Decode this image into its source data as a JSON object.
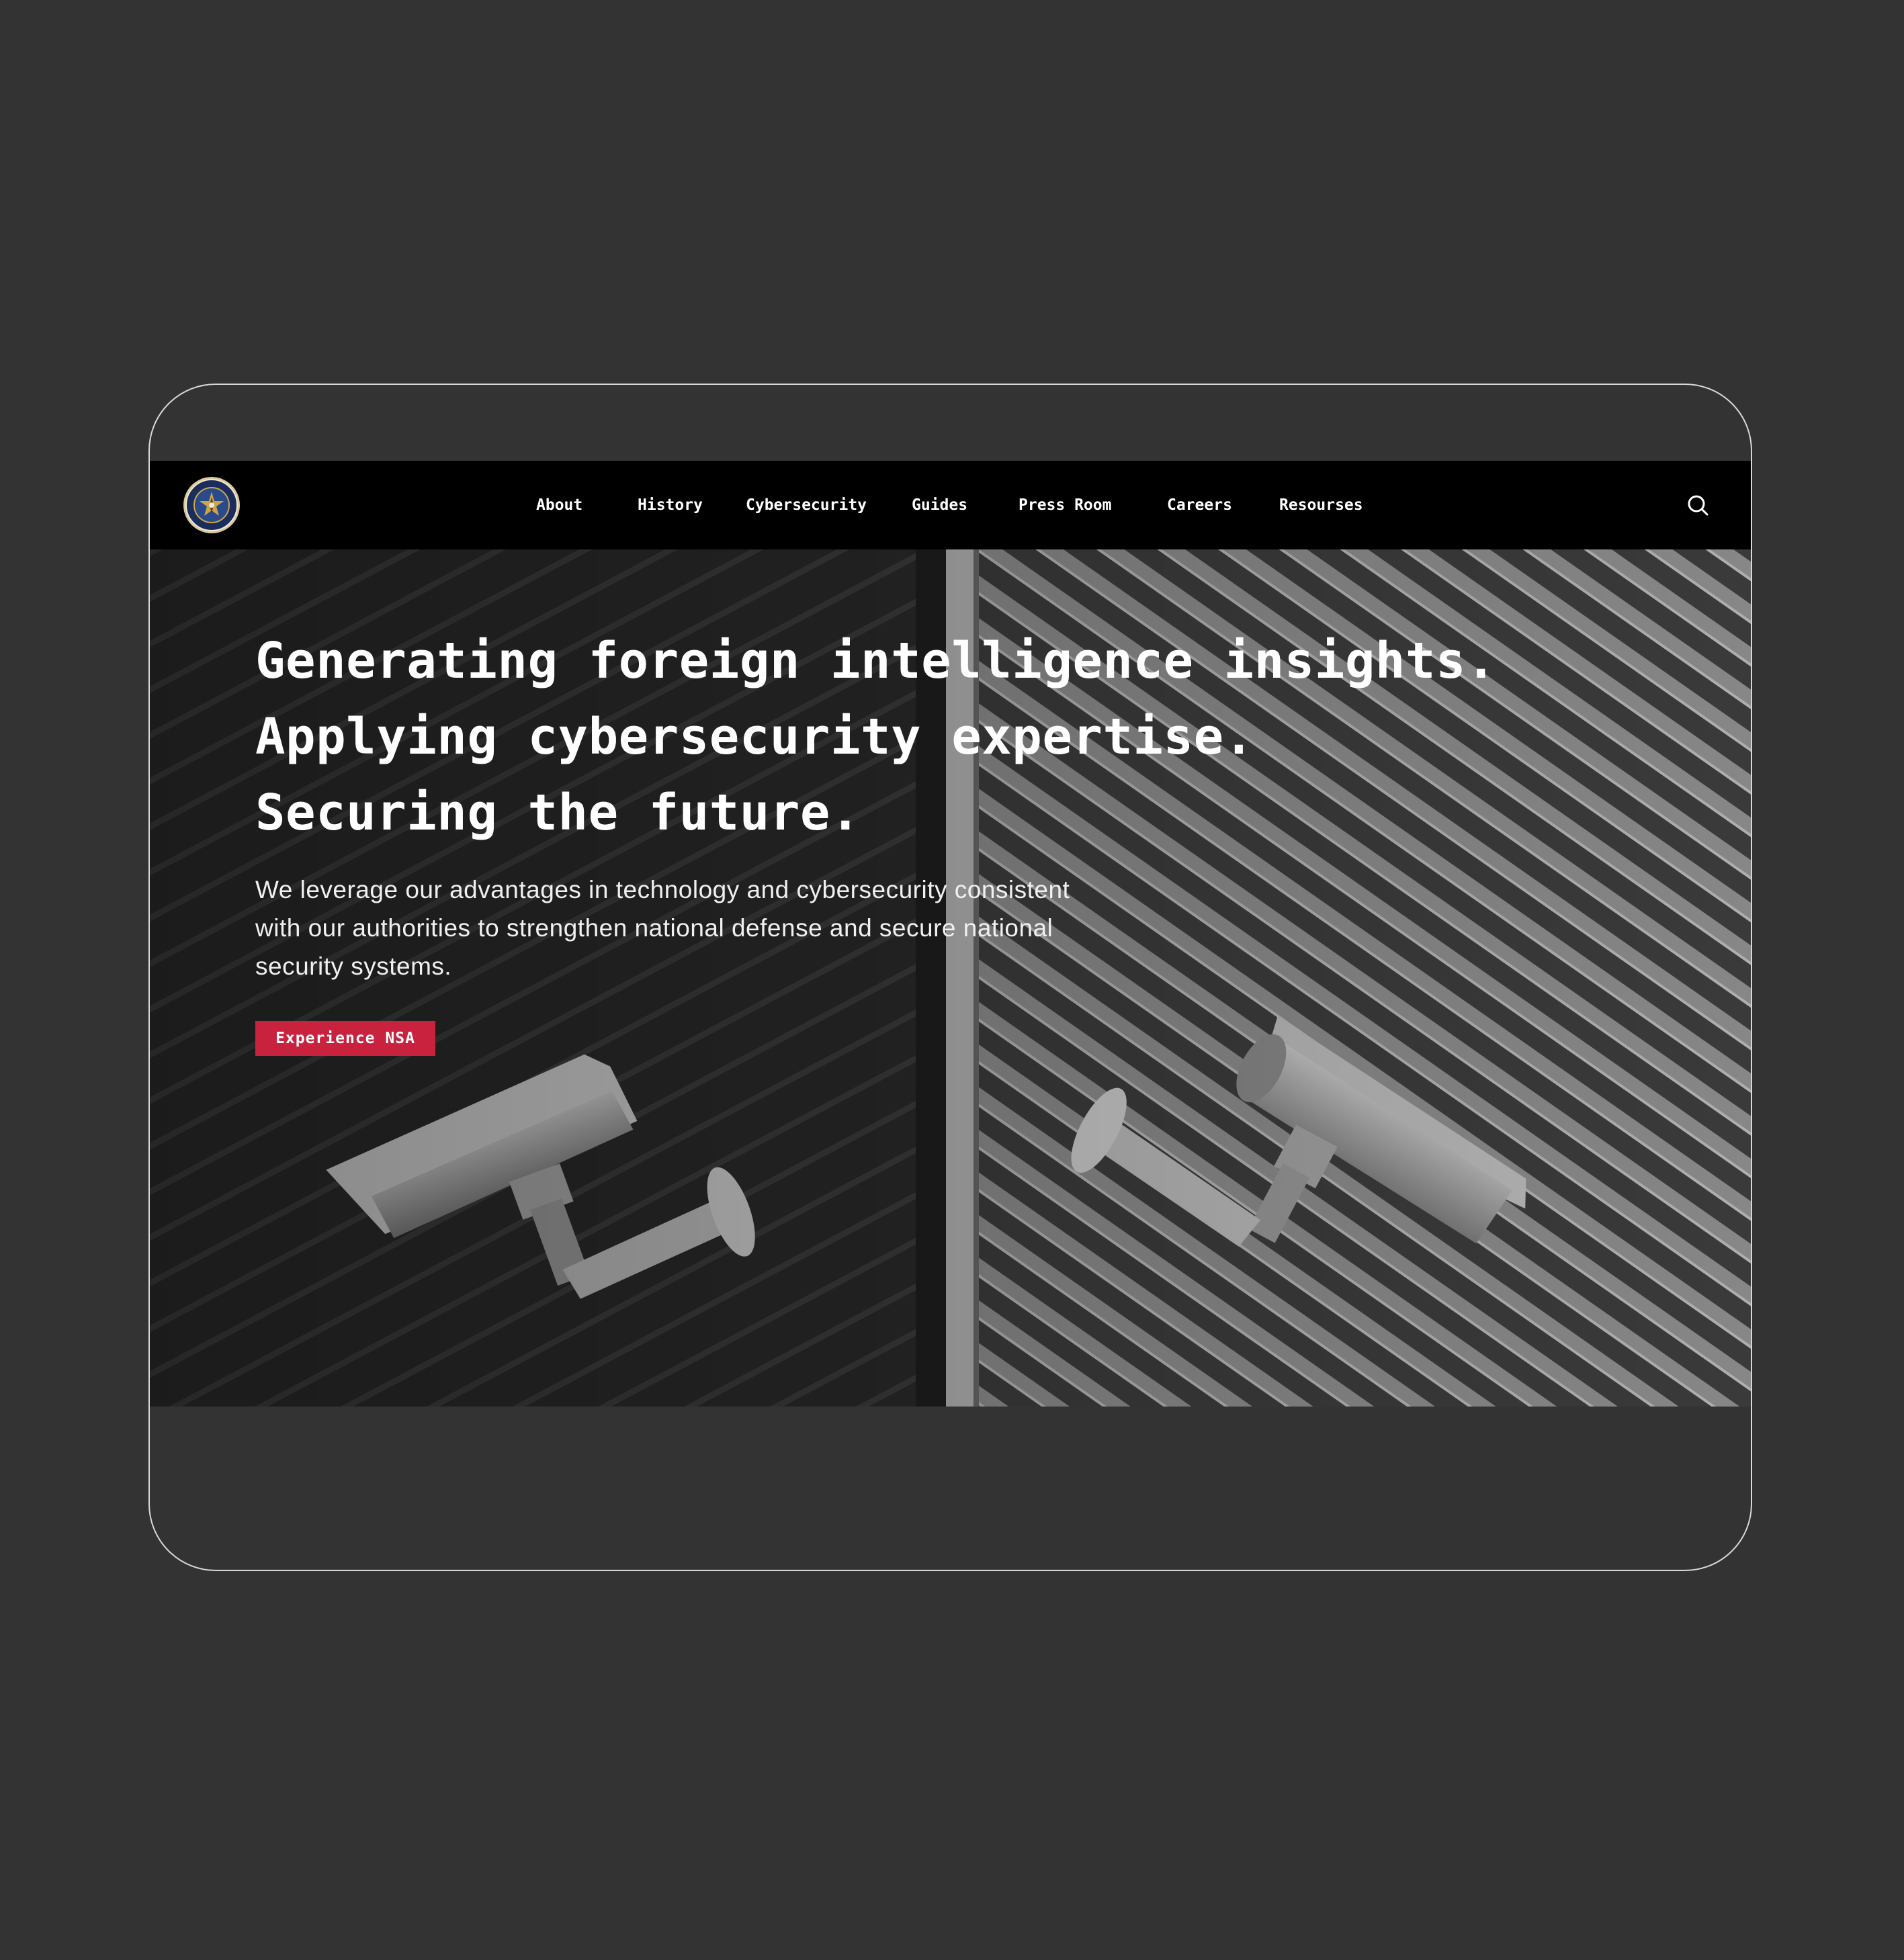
{
  "site": {
    "logo_icon": "nsa-seal-icon"
  },
  "nav": {
    "items": [
      {
        "label": "About"
      },
      {
        "label": "History"
      },
      {
        "label": "Cybersecurity"
      },
      {
        "label": "Guides"
      },
      {
        "label": "Press Room"
      },
      {
        "label": "Careers"
      },
      {
        "label": "Resourses"
      }
    ],
    "search_icon": "search-icon"
  },
  "hero": {
    "headline": [
      "Generating foreign intelligence insights.",
      "Applying cybersecurity expertise.",
      "Securing the future."
    ],
    "subtext": "We leverage our advantages in technology and cybersecurity consistent with our authorities to strengthen national defense and secure national security systems.",
    "cta_label": "Experience NSA",
    "background": "security-cameras-photo"
  },
  "colors": {
    "page_background": "#333333",
    "navbar_background": "#000000",
    "accent": "#c8223f",
    "text": "#ffffff"
  }
}
